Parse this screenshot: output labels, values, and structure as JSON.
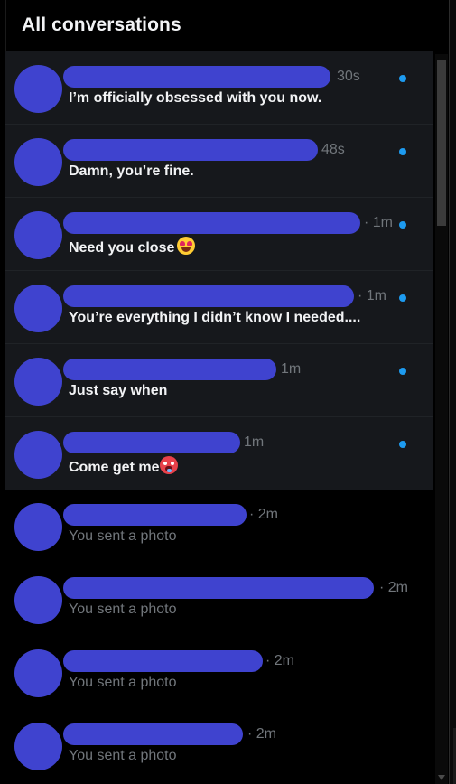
{
  "header": {
    "title": "All conversations"
  },
  "colors": {
    "avatar": "#3f43cf",
    "unread_dot": "#1d9bf0",
    "muted_text": "#71767b",
    "unread_row_bg": "#16181c"
  },
  "conversations": [
    {
      "time": "30s",
      "preview": "I’m officially obsessed with you now.",
      "unread": true,
      "emoji": null
    },
    {
      "time": "48s",
      "preview": "Damn, you’re fine.",
      "unread": true,
      "emoji": null
    },
    {
      "time": "· 1m",
      "preview": "Need you close",
      "unread": true,
      "emoji": "smiling-face-with-heart-eyes-icon"
    },
    {
      "time": "· 1m",
      "preview": "You’re everything I didn’t know I needed....",
      "unread": true,
      "emoji": null
    },
    {
      "time": "1m",
      "preview": "Just say when",
      "unread": true,
      "emoji": null
    },
    {
      "time": "1m",
      "preview": "Come get me",
      "unread": true,
      "emoji": "hot-face-icon"
    },
    {
      "time": "· 2m",
      "preview": "You sent a photo",
      "unread": false,
      "emoji": null
    },
    {
      "time": "· 2m",
      "preview": "You sent a photo",
      "unread": false,
      "emoji": null
    },
    {
      "time": "· 2m",
      "preview": "You sent a photo",
      "unread": false,
      "emoji": null
    },
    {
      "time": "· 2m",
      "preview": "You sent a photo",
      "unread": false,
      "emoji": null
    }
  ]
}
